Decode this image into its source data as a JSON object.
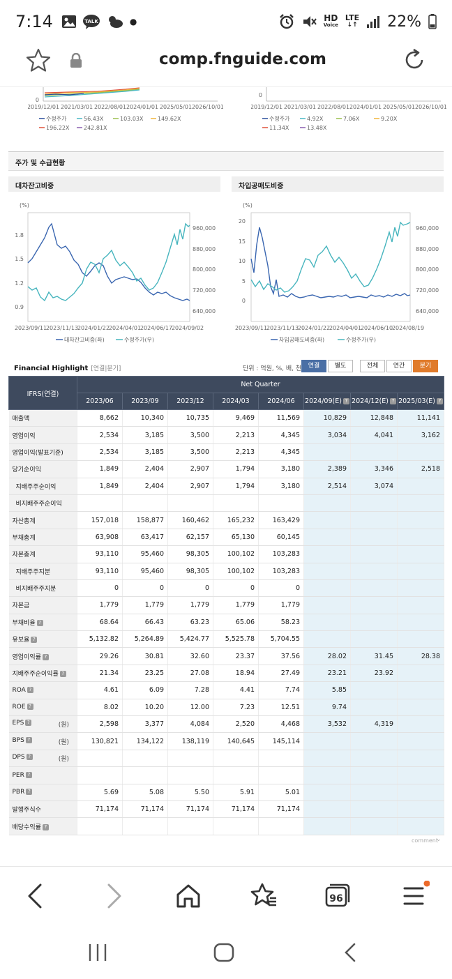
{
  "status": {
    "time": "7:14",
    "battery": "22%",
    "network": "LTE",
    "hd": "HD",
    "voice": "Voice",
    "talk": "TALK"
  },
  "browser": {
    "url": "comp.fnguide.com",
    "tab_count": "96"
  },
  "top_charts": {
    "left_xticks": [
      "2019/12/01",
      "2021/03/01",
      "2022/08/01",
      "2024/01/01",
      "2025/05/01",
      "2026/10/01"
    ],
    "right_xticks": [
      "2019/12/01",
      "2021/03/01",
      "2022/08/01",
      "2024/01/01",
      "2025/05/01",
      "2026/10/01"
    ],
    "left_y0": "0",
    "right_y0": "0",
    "left_legend": [
      "수정주가",
      "56.43X",
      "103.03X",
      "149.62X",
      "196.22X",
      "242.81X"
    ],
    "right_legend": [
      "수정주가",
      "4.92X",
      "7.06X",
      "9.20X",
      "11.34X",
      "13.48X"
    ],
    "legend_colors": [
      "#2a4d9b",
      "#49b8c4",
      "#9bc14f",
      "#f0b63c",
      "#e0533c",
      "#8a5fb0"
    ]
  },
  "section_title": "주가 및 수급현황",
  "chart1": {
    "title": "대차잔고비중",
    "unit": "(%)",
    "yleft": [
      "1.8",
      "1.5",
      "1.2",
      "0.9"
    ],
    "yright": [
      "960,000",
      "880,000",
      "800,000",
      "720,000",
      "640,000"
    ],
    "xticks": [
      "2023/09/11",
      "2023/11/13",
      "2024/01/22",
      "2024/04/01",
      "2024/06/17",
      "2024/09/02"
    ],
    "legend": [
      "대차잔고비중(좌)",
      "수정주가(우)"
    ]
  },
  "chart2": {
    "title": "차입공매도비중",
    "unit": "(%)",
    "yleft": [
      "20",
      "15",
      "10",
      "5",
      "0"
    ],
    "yright": [
      "960,000",
      "880,000",
      "800,000",
      "720,000",
      "640,000"
    ],
    "xticks": [
      "2023/09/11",
      "2023/11/13",
      "2024/01/22",
      "2024/04/01",
      "2024/06/10",
      "2024/08/19"
    ],
    "legend": [
      "차입공매도비중(좌)",
      "수정주가(우)"
    ]
  },
  "series_colors": {
    "primary": "#3a66b0",
    "price": "#47b5be"
  },
  "fh": {
    "title": "Financial Highlight",
    "subtitle": "[연결|분기]",
    "unit": "단위 : 억원, %, 배, 천주",
    "btn_consol": "연결",
    "btn_separate": "별도",
    "btn_all": "전체",
    "btn_annual": "연간",
    "btn_quarter": "분기",
    "ifrs": "IFRS(연결)",
    "group": "Net Quarter",
    "periods": [
      "2023/06",
      "2023/09",
      "2023/12",
      "2024/03",
      "2024/06",
      "2024/09(E)",
      "2024/12(E)",
      "2025/03(E)"
    ],
    "won": "(원)",
    "comment": "comment",
    "rows": [
      {
        "label": "매출액",
        "v": [
          "8,662",
          "10,340",
          "10,735",
          "9,469",
          "11,569",
          "10,829",
          "12,848",
          "11,141"
        ]
      },
      {
        "label": "영업이익",
        "v": [
          "2,534",
          "3,185",
          "3,500",
          "2,213",
          "4,345",
          "3,034",
          "4,041",
          "3,162"
        ]
      },
      {
        "label": "영업이익(발표기준)",
        "v": [
          "2,534",
          "3,185",
          "3,500",
          "2,213",
          "4,345",
          "",
          "",
          ""
        ]
      },
      {
        "label": "당기순이익",
        "v": [
          "1,849",
          "2,404",
          "2,907",
          "1,794",
          "3,180",
          "2,389",
          "3,346",
          "2,518"
        ]
      },
      {
        "label": "지배주주순이익",
        "v": [
          "1,849",
          "2,404",
          "2,907",
          "1,794",
          "3,180",
          "2,514",
          "3,074",
          ""
        ]
      },
      {
        "label": "비지배주주순이익",
        "v": [
          "",
          "",
          "",
          "",
          "",
          "",
          "",
          ""
        ]
      },
      {
        "label": "자산총계",
        "v": [
          "157,018",
          "158,877",
          "160,462",
          "165,232",
          "163,429",
          "",
          "",
          ""
        ]
      },
      {
        "label": "부채총계",
        "v": [
          "63,908",
          "63,417",
          "62,157",
          "65,130",
          "60,145",
          "",
          "",
          ""
        ]
      },
      {
        "label": "자본총계",
        "v": [
          "93,110",
          "95,460",
          "98,305",
          "100,102",
          "103,283",
          "",
          "",
          ""
        ]
      },
      {
        "label": "지배주주지분",
        "v": [
          "93,110",
          "95,460",
          "98,305",
          "100,102",
          "103,283",
          "",
          "",
          ""
        ]
      },
      {
        "label": "비지배주주지분",
        "v": [
          "0",
          "0",
          "0",
          "0",
          "0",
          "",
          "",
          ""
        ]
      },
      {
        "label": "자본금",
        "v": [
          "1,779",
          "1,779",
          "1,779",
          "1,779",
          "1,779",
          "",
          "",
          ""
        ]
      },
      {
        "label": "부채비율",
        "v": [
          "68.64",
          "66.43",
          "63.23",
          "65.06",
          "58.23",
          "",
          "",
          ""
        ]
      },
      {
        "label": "유보율",
        "v": [
          "5,132.82",
          "5,264.89",
          "5,424.77",
          "5,525.78",
          "5,704.55",
          "",
          "",
          ""
        ]
      },
      {
        "label": "영업이익률",
        "v": [
          "29.26",
          "30.81",
          "32.60",
          "23.37",
          "37.56",
          "28.02",
          "31.45",
          "28.38"
        ]
      },
      {
        "label": "지배주주순이익률",
        "v": [
          "21.34",
          "23.25",
          "27.08",
          "18.94",
          "27.49",
          "23.21",
          "23.92",
          ""
        ]
      },
      {
        "label": "ROA",
        "v": [
          "4.61",
          "6.09",
          "7.28",
          "4.41",
          "7.74",
          "5.85",
          "",
          ""
        ]
      },
      {
        "label": "ROE",
        "v": [
          "8.02",
          "10.20",
          "12.00",
          "7.23",
          "12.51",
          "9.74",
          "",
          ""
        ]
      },
      {
        "label": "EPS",
        "v": [
          "2,598",
          "3,377",
          "4,084",
          "2,520",
          "4,468",
          "3,532",
          "4,319",
          ""
        ]
      },
      {
        "label": "BPS",
        "v": [
          "130,821",
          "134,122",
          "138,119",
          "140,645",
          "145,114",
          "",
          "",
          ""
        ]
      },
      {
        "label": "DPS",
        "v": [
          "",
          "",
          "",
          "",
          "",
          "",
          "",
          ""
        ]
      },
      {
        "label": "PER",
        "v": [
          "",
          "",
          "",
          "",
          "",
          "",
          "",
          ""
        ]
      },
      {
        "label": "PBR",
        "v": [
          "5.69",
          "5.08",
          "5.50",
          "5.91",
          "5.01",
          "",
          "",
          ""
        ]
      },
      {
        "label": "발행주식수",
        "v": [
          "71,174",
          "71,174",
          "71,174",
          "71,174",
          "71,174",
          "",
          "",
          ""
        ]
      },
      {
        "label": "배당수익률",
        "v": [
          "",
          "",
          "",
          "",
          "",
          "",
          "",
          ""
        ]
      }
    ]
  }
}
